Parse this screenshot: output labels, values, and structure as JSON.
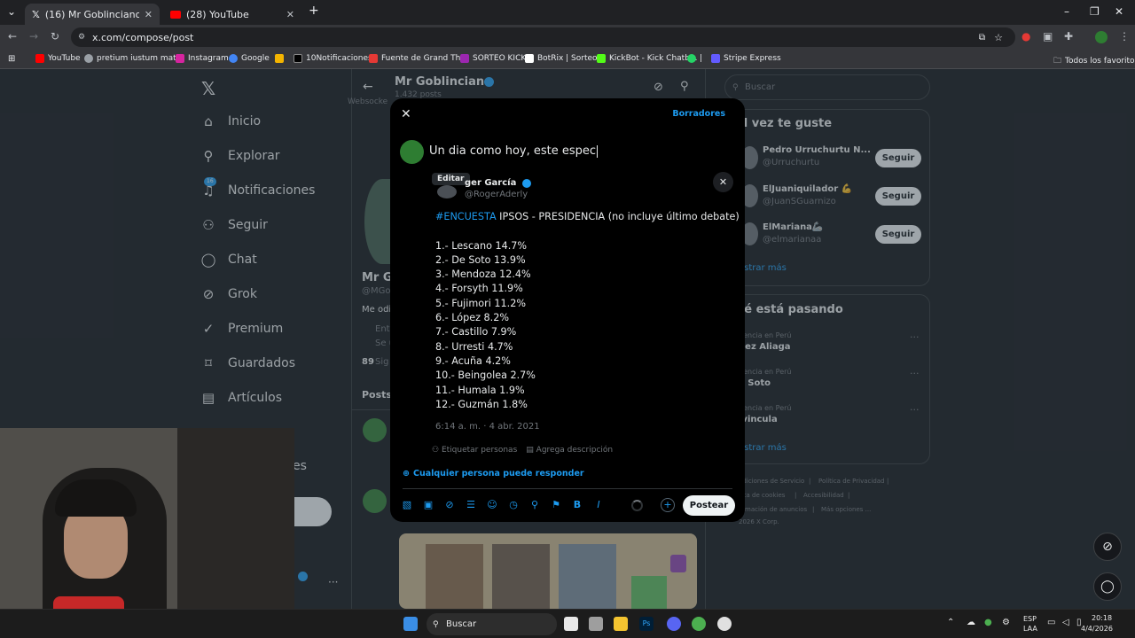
{
  "browser": {
    "tabs": [
      {
        "label": "(16) Mr Goblinciano (@MGoblin",
        "favicon": "x-icon",
        "active": true
      },
      {
        "label": "(28) YouTube",
        "favicon": "youtube-icon",
        "active": false
      }
    ],
    "url": "x.com/compose/post",
    "bookmarks": [
      {
        "label": "YouTube",
        "icon": "youtube-icon",
        "color": "#ff0000"
      },
      {
        "label": "pretium iustum mat...",
        "icon": "globe-icon",
        "color": "#9aa0a6"
      },
      {
        "label": "Instagram",
        "icon": "instagram-icon",
        "color": "#d6249f"
      },
      {
        "label": "Google",
        "icon": "google-icon",
        "color": "#4285f4"
      },
      {
        "label": "",
        "icon": "colorful-icon",
        "color": "#f4b400"
      },
      {
        "label": "10Notificaciones",
        "icon": "x-icon",
        "color": "#000000"
      },
      {
        "label": "Fuente de Grand Th...",
        "icon": "f-icon",
        "color": "#e53935"
      },
      {
        "label": "SORTEO KICK",
        "icon": "sparkle-icon",
        "color": "#9c27b0"
      },
      {
        "label": "BotRix | Sorteos",
        "icon": "bot-icon",
        "color": "#ffffff"
      },
      {
        "label": "KickBot - Kick Chatb...",
        "icon": "kickbot-icon",
        "color": "#53fc18"
      },
      {
        "label": "|",
        "icon": "whatsapp-icon",
        "color": "#25d366"
      },
      {
        "label": "Stripe Express",
        "icon": "stripe-icon",
        "color": "#635bff"
      }
    ],
    "all_bookmarks": "Todos los favoritos"
  },
  "sidebar": {
    "items": [
      {
        "label": "Inicio",
        "icon": "home-icon",
        "glyph": "⌂"
      },
      {
        "label": "Explorar",
        "icon": "search-icon",
        "glyph": "⚲"
      },
      {
        "label": "Notificaciones",
        "icon": "bell-icon",
        "glyph": "🔔",
        "badge": "16"
      },
      {
        "label": "Seguir",
        "icon": "add-user-icon",
        "glyph": "⍝"
      },
      {
        "label": "Chat",
        "icon": "chat-icon",
        "glyph": "◯"
      },
      {
        "label": "Grok",
        "icon": "grok-icon",
        "glyph": "⊘"
      },
      {
        "label": "Premium",
        "icon": "premium-icon",
        "glyph": "✓"
      },
      {
        "label": "Guardados",
        "icon": "bookmark-icon",
        "glyph": "⌑"
      },
      {
        "label": "Artículos",
        "icon": "article-icon",
        "glyph": "▤"
      }
    ],
    "partial_item": "es"
  },
  "profile": {
    "name": "Mr Goblinciano",
    "posts_count": "1.432 posts",
    "short_name": "Mr G",
    "short_handle": "@MGo",
    "bio_start": "Me odi",
    "meta1": "Ent",
    "meta2": "Se u",
    "following": "89",
    "following_label": "Sig",
    "tab": "Posts",
    "websocket_text": "Websocke"
  },
  "right": {
    "search_placeholder": "Buscar",
    "suggest_title": "al vez te guste",
    "suggestions": [
      {
        "name": "Pedro Urruchurtu N...",
        "handle": "@Urruchurtu",
        "button": "Seguir"
      },
      {
        "name": "ElJuaniquilador 💪",
        "handle": "@JuanSGuarnizo",
        "button": "Seguir"
      },
      {
        "name": "ElMariana🦾",
        "handle": "@elmarianaa",
        "button": "Seguir"
      }
    ],
    "show_more": "ostrar más",
    "happening_title": "ué está pasando",
    "trends": [
      {
        "context": "dencia en Perú",
        "name": "pez Aliaga"
      },
      {
        "context": "dencia en Perú",
        "name": "e Soto"
      },
      {
        "context": "dencia en Perú",
        "name": "lvincula"
      }
    ],
    "show_more2": "ostrar más",
    "footer": [
      "ndiciones de Servicio",
      "|",
      "Política de Privacidad",
      "|",
      "tica de cookies",
      "|",
      "Accesibilidad",
      "|",
      "ormación de anuncios",
      "|",
      "Más opciones ...",
      "2026 X Corp."
    ]
  },
  "compose": {
    "drafts": "Borradores",
    "text": "Un dia como hoy,  este espec",
    "edit_badge": "Editar",
    "quoted": {
      "name": "ger García",
      "handle": "@RogerAderly",
      "hashtag": "#ENCUESTA",
      "headline": " IPSOS - PRESIDENCIA (no incluye último debate)",
      "lines": [
        "1.- Lescano 14.7%",
        "2.- De Soto 13.9%",
        "3.- Mendoza 12.4%",
        "4.- Forsyth 11.9%",
        "5.- Fujimori 11.2%",
        "6.- López 8.2%",
        "7.- Castillo 7.9%",
        "8.- Urresti 4.7%",
        "9.- Acuña 4.2%",
        "10.- Beingolea 2.7%",
        "11.- Humala 1.9%",
        "12.- Guzmán 1.8%"
      ],
      "date": "6:14 a. m. · 4 abr. 2021",
      "tag_people": "Etiquetar personas",
      "add_description": "Agrega descripción"
    },
    "reply_setting": "Cualquier persona puede responder",
    "post_button": "Postear"
  },
  "taskbar": {
    "search": "Buscar",
    "lang": "ESP",
    "lang2": "LAA",
    "time": "20:18",
    "date": "4/4/2026"
  }
}
